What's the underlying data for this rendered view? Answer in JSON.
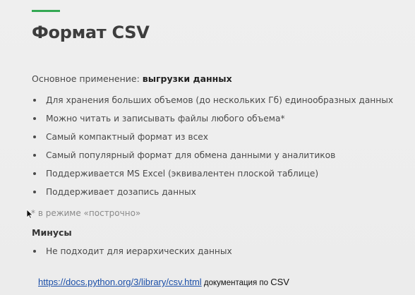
{
  "slide": {
    "title": "Формат CSV",
    "accent_color": "#34a853",
    "usage_label": "Основное применение: ",
    "usage_value": "выгрузки данных",
    "bullets": [
      "Для хранения больших объемов (до нескольких Гб) единообразных данных",
      "Можно читать и записывать файлы любого объема*",
      "Самый компактный формат из всех",
      "Самый популярный формат для обмена данными у аналитиков",
      "Поддерживается MS Excel (эквивалентен плоской таблице)",
      "Поддерживает дозапись данных"
    ],
    "footnote": "* в режиме «построчно»",
    "minus_heading": "Минусы",
    "minus_bullets": [
      "Не подходит для иерархических данных"
    ],
    "doc_link_text": "https://docs.python.org/3/library/csv.html",
    "doc_text": " документация по ",
    "doc_csv": "CSV"
  }
}
